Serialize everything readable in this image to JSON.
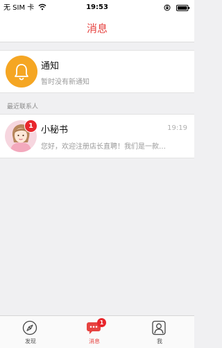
{
  "status_bar": {
    "carrier": "无 SIM 卡",
    "time": "19:53"
  },
  "nav": {
    "title": "消息"
  },
  "notice": {
    "title": "通知",
    "subtitle": "暂时没有新通知",
    "icon": "bell-icon",
    "color": "#f5a623"
  },
  "recent_contacts": {
    "header": "最近联系人",
    "items": [
      {
        "name": "小秘书",
        "time": "19:19",
        "preview": "您好，欢迎注册店长直聘！我们是一款…",
        "unread": "1"
      }
    ]
  },
  "tabbar": {
    "tabs": [
      {
        "label": "发现",
        "icon": "compass-icon"
      },
      {
        "label": "消息",
        "icon": "chat-bubble-icon",
        "badge": "1",
        "active": true
      },
      {
        "label": "我",
        "icon": "user-icon"
      }
    ]
  },
  "colors": {
    "accent": "#e64340",
    "badge": "#e8262c"
  }
}
